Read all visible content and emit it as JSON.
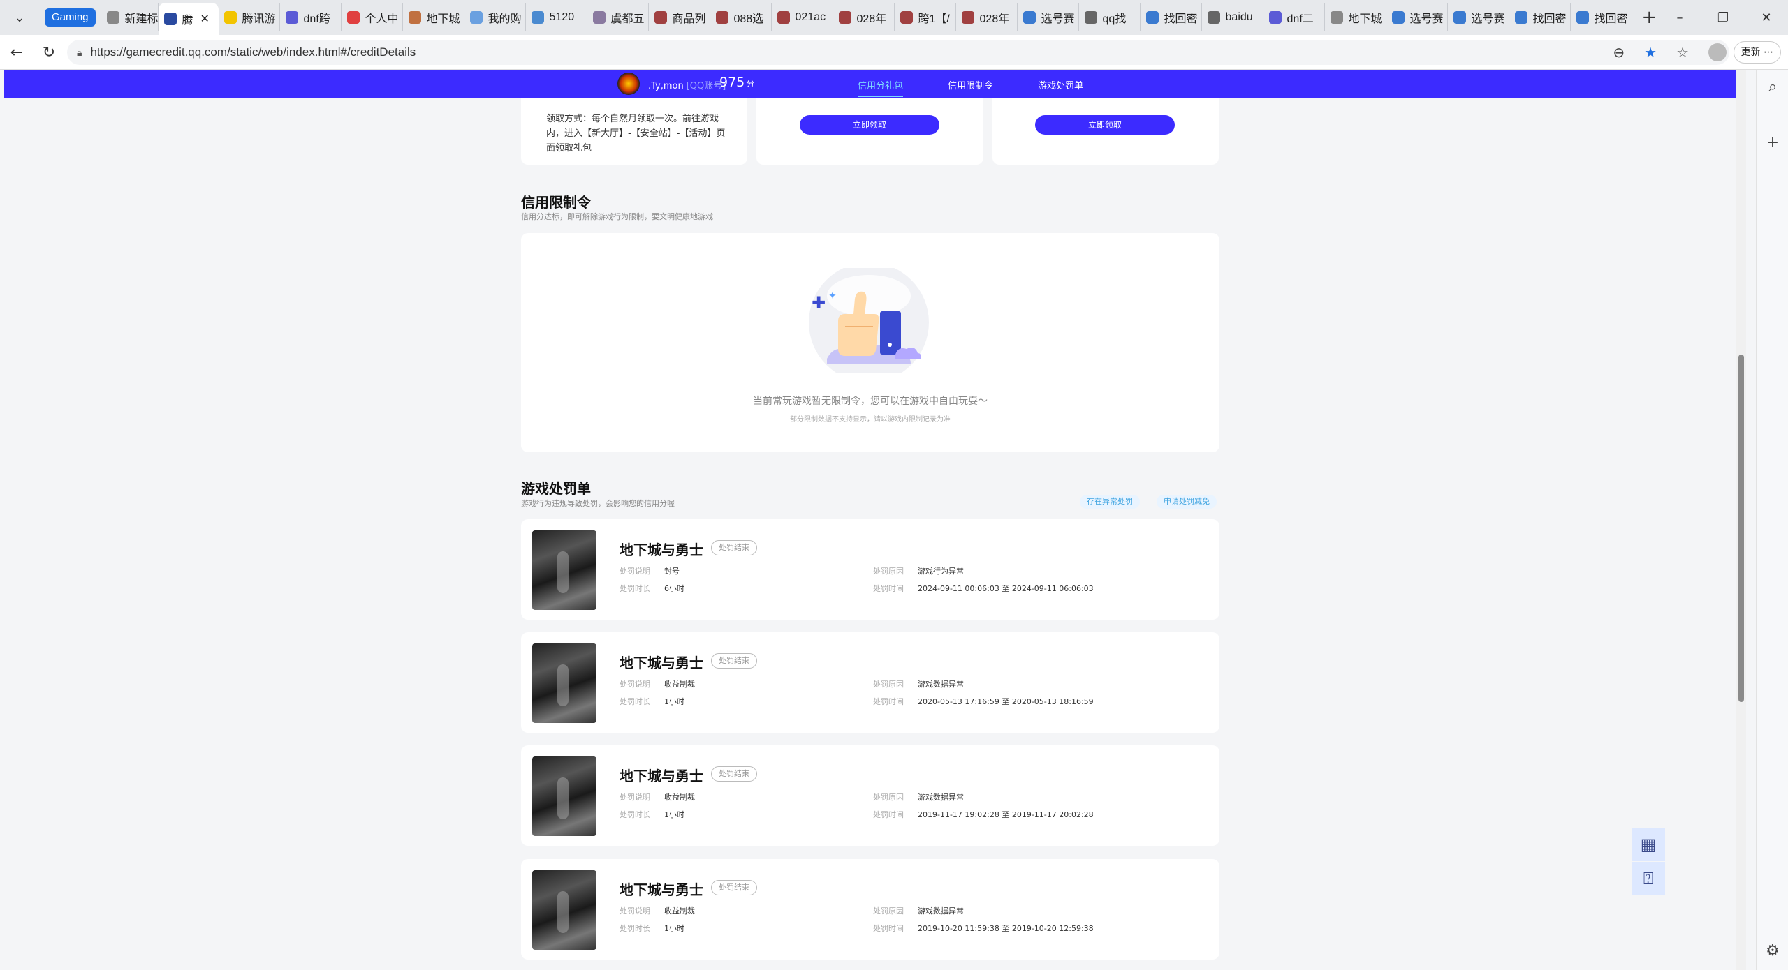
{
  "browser": {
    "gaming_label": "Gaming",
    "tabs": [
      {
        "label": "新建标",
        "color": "#888"
      },
      {
        "label": "腾",
        "color": "#2a4aa0",
        "active": true
      },
      {
        "label": "腾讯游",
        "color": "#f2c400"
      },
      {
        "label": "dnf跨",
        "color": "#5b5bd6"
      },
      {
        "label": "个人中",
        "color": "#e04040"
      },
      {
        "label": "地下城",
        "color": "#c07040"
      },
      {
        "label": "我的购",
        "color": "#6aa0e0"
      },
      {
        "label": "5120",
        "color": "#4a8ad0"
      },
      {
        "label": "虞都五",
        "color": "#8a7aa0"
      },
      {
        "label": "商品列",
        "color": "#a04040"
      },
      {
        "label": "088选",
        "color": "#a04040"
      },
      {
        "label": "021ac",
        "color": "#a04040"
      },
      {
        "label": "028年",
        "color": "#a04040"
      },
      {
        "label": "跨1【/",
        "color": "#a04040"
      },
      {
        "label": "028年",
        "color": "#a04040"
      },
      {
        "label": "选号赛",
        "color": "#3a7ad0"
      },
      {
        "label": "qq找",
        "color": "#666"
      },
      {
        "label": "找回密",
        "color": "#3a7ad0"
      },
      {
        "label": "baidu",
        "color": "#666"
      },
      {
        "label": "dnf二",
        "color": "#5b5bd6"
      },
      {
        "label": "地下城",
        "color": "#888"
      },
      {
        "label": "选号赛",
        "color": "#3a7ad0"
      },
      {
        "label": "选号赛",
        "color": "#3a7ad0"
      },
      {
        "label": "找回密",
        "color": "#3a7ad0"
      },
      {
        "label": "找回密",
        "color": "#3a7ad0"
      }
    ],
    "url": "https://gamecredit.qq.com/static/web/index.html#/creditDetails",
    "update_label": "更新"
  },
  "user": {
    "name": ".Ty,mon",
    "account_type": "[QQ账号]",
    "score": "975",
    "score_unit": "分"
  },
  "nav": {
    "tabs": [
      "信用分礼包",
      "信用限制令",
      "游戏处罚单"
    ],
    "active_index": 0
  },
  "gift": {
    "method_text": "领取方式：每个自然月领取一次。前往游戏内，进入【新大厅】-【安全站】-【活动】页面领取礼包",
    "claim_label": "立即领取"
  },
  "restriction": {
    "title": "信用限制令",
    "subtitle": "信用分达标，即可解除游戏行为限制，要文明健康地游戏",
    "empty_main": "当前常玩游戏暂无限制令，您可以在游戏中自由玩耍～",
    "empty_note": "部分限制数据不支持显示，请以游戏内限制记录为准"
  },
  "penalty": {
    "title": "游戏处罚单",
    "subtitle": "游戏行为违规导致处罚，会影响您的信用分喔",
    "btn_exception": "存在异常处罚",
    "btn_reduce": "申请处罚减免",
    "labels": {
      "desc": "处罚说明",
      "duration": "处罚时长",
      "reason": "处罚原因",
      "time": "处罚时间"
    },
    "items": [
      {
        "game": "地下城与勇士",
        "status": "处罚结束",
        "desc": "封号",
        "duration": "6小时",
        "reason": "游戏行为异常",
        "time": "2024-09-11 00:06:03 至 2024-09-11 06:06:03"
      },
      {
        "game": "地下城与勇士",
        "status": "处罚结束",
        "desc": "收益制裁",
        "duration": "1小时",
        "reason": "游戏数据异常",
        "time": "2020-05-13 17:16:59 至 2020-05-13 18:16:59"
      },
      {
        "game": "地下城与勇士",
        "status": "处罚结束",
        "desc": "收益制裁",
        "duration": "1小时",
        "reason": "游戏数据异常",
        "time": "2019-11-17 19:02:28 至 2019-11-17 20:02:28"
      },
      {
        "game": "地下城与勇士",
        "status": "处罚结束",
        "desc": "收益制裁",
        "duration": "1小时",
        "reason": "游戏数据异常",
        "time": "2019-10-20 11:59:38 至 2019-10-20 12:59:38"
      }
    ]
  },
  "colors": {
    "brand": "#3c2bff",
    "accent": "#7fd9ff"
  }
}
